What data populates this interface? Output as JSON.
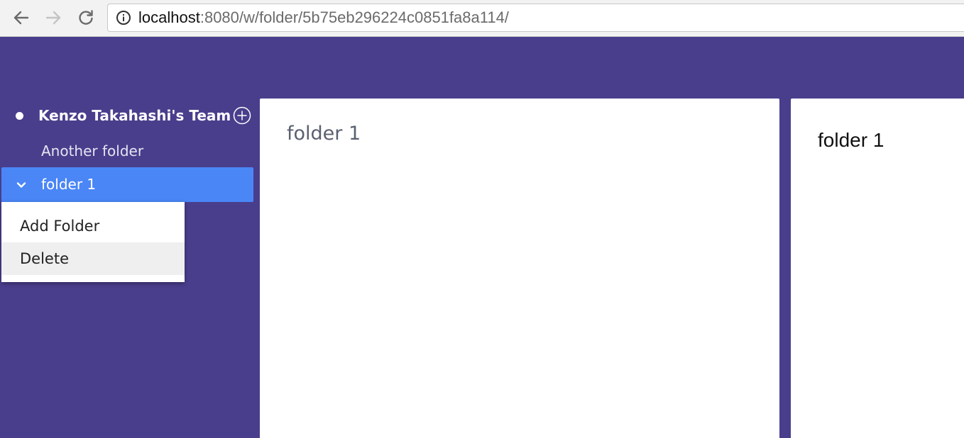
{
  "browser": {
    "url_host": "localhost",
    "url_path": ":8080/w/folder/5b75eb296224c0851fa8a114/",
    "icons": {
      "back": "arrow-left-icon",
      "forward": "arrow-right-icon",
      "reload": "reload-icon",
      "site_info": "info-icon"
    }
  },
  "sidebar": {
    "team_name": "Kenzo Takahashi's Team",
    "items": [
      {
        "label": "Another folder",
        "active": false
      },
      {
        "label": "folder 1",
        "active": true
      }
    ]
  },
  "context_menu": {
    "items": [
      {
        "label": "Add Folder",
        "hovered": false
      },
      {
        "label": "Delete",
        "hovered": true
      }
    ]
  },
  "main_panel": {
    "title": "folder 1"
  },
  "right_panel": {
    "title": "folder 1"
  },
  "colors": {
    "background": "#493e8c",
    "active_item": "#4a86f6",
    "panel": "#ffffff"
  }
}
